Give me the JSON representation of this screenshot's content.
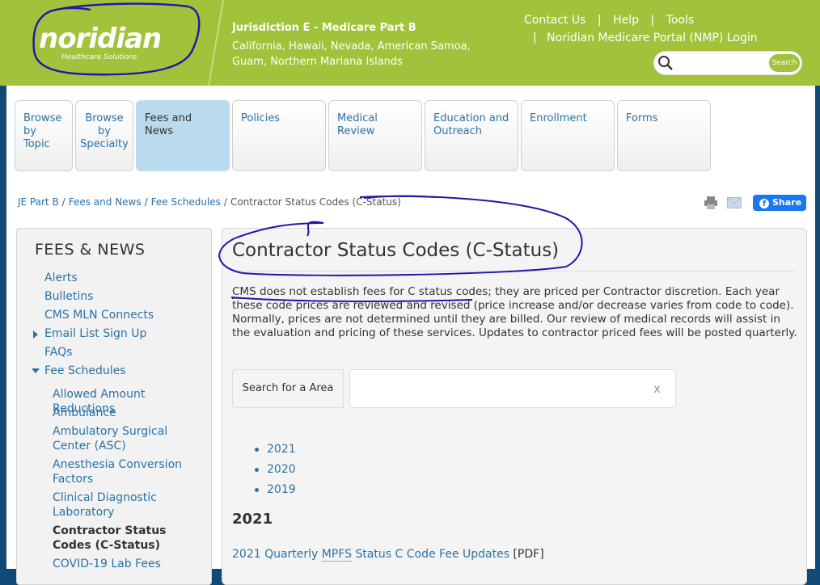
{
  "header": {
    "brand": "noridian",
    "brand_sub": "Healthcare Solutions",
    "jurisdiction": "Jurisdiction E - Medicare Part B",
    "regions": "California, Hawaii, Nevada, American Samoa, Guam, Northern Mariana Islands",
    "links": [
      "Contact Us",
      "Help",
      "Tools"
    ],
    "portal_link": "Noridian Medicare Portal (NMP) Login",
    "search_button": "Search",
    "search_placeholder": ""
  },
  "nav": {
    "tabs": [
      {
        "label": "Browse by Topic"
      },
      {
        "label": "Browse by Specialty"
      },
      {
        "label": "Fees and News",
        "active": true
      },
      {
        "label": "Policies"
      },
      {
        "label": "Medical Review"
      },
      {
        "label": "Education and Outreach"
      },
      {
        "label": "Enrollment"
      },
      {
        "label": "Forms"
      }
    ]
  },
  "breadcrumb": {
    "items": [
      "JE Part B",
      "Fees and News",
      "Fee Schedules"
    ],
    "current": "Contractor Status Codes (C-Status)"
  },
  "share_label": "Share",
  "sidebar": {
    "title": "FEES & NEWS",
    "items": [
      "Alerts",
      "Bulletins",
      "CMS MLN Connects",
      "Email List Sign Up",
      "FAQs",
      "Fee Schedules"
    ],
    "sub_items": [
      "Allowed Amount Reductions",
      "Ambulance",
      "Ambulatory Surgical Center (ASC)",
      "Anesthesia Conversion Factors",
      "Clinical Diagnostic Laboratory",
      "Contractor Status Codes (C-Status)",
      "COVID-19 Lab Fees"
    ]
  },
  "main": {
    "title": "Contractor Status Codes (C-Status)",
    "intro_cms": "CMS",
    "intro_rest": " does not establish fees for C status codes; they are priced per Contractor discretion. Each year these code prices are reviewed and revised (price increase and/or decrease varies from code to code). Normally, prices are not determined until they are billed. Our review of medical records will assist in the evaluation and pricing of these services. Updates to contractor priced fees will be posted quarterly.",
    "search_label": "Search for a Area",
    "search_value": "",
    "clear_label": "x",
    "years": [
      "2021",
      "2020",
      "2019"
    ],
    "year_heading": "2021",
    "doc_link_pre": "2021 Quarterly ",
    "doc_link_mpfs": "MPFS",
    "doc_link_post": " Status C Code Fee Updates",
    "doc_type": "[PDF]"
  },
  "colors": {
    "header_green": "#a2c23b",
    "link_blue": "#2a72a8",
    "active_tab": "#b9dbed",
    "facebook": "#1877f2",
    "annotation_ink": "#1a1aa8"
  }
}
